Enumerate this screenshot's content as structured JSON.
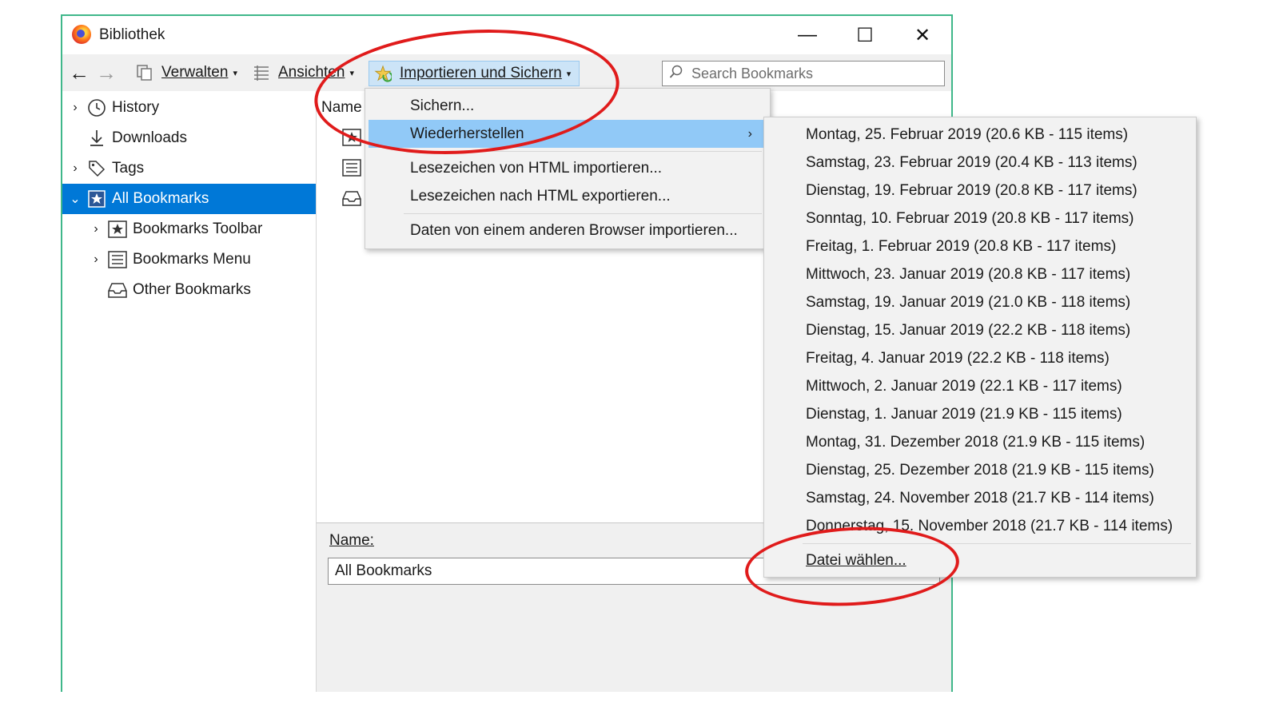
{
  "window": {
    "title": "Bibliothek"
  },
  "toolbar": {
    "verwalten": "Verwalten",
    "ansichten": "Ansichten",
    "import_backup": "Importieren und Sichern",
    "search_placeholder": "Search Bookmarks"
  },
  "sidebar": {
    "items": [
      {
        "label": "History"
      },
      {
        "label": "Downloads"
      },
      {
        "label": "Tags"
      },
      {
        "label": "All Bookmarks"
      },
      {
        "label": "Bookmarks Toolbar"
      },
      {
        "label": "Bookmarks Menu"
      },
      {
        "label": "Other Bookmarks"
      }
    ]
  },
  "list": {
    "column_name": "Name"
  },
  "details": {
    "name_label": "Name:",
    "name_value": "All Bookmarks"
  },
  "import_menu": {
    "items": [
      "Sichern...",
      "Wiederherstellen",
      "Lesezeichen von HTML importieren...",
      "Lesezeichen nach HTML exportieren...",
      "Daten von einem anderen Browser importieren..."
    ]
  },
  "restore_menu": {
    "backups": [
      "Montag, 25. Februar 2019 (20.6 KB - 115 items)",
      "Samstag, 23. Februar 2019 (20.4 KB - 113 items)",
      "Dienstag, 19. Februar 2019 (20.8 KB - 117 items)",
      "Sonntag, 10. Februar 2019 (20.8 KB - 117 items)",
      "Freitag, 1. Februar 2019 (20.8 KB - 117 items)",
      "Mittwoch, 23. Januar 2019 (20.8 KB - 117 items)",
      "Samstag, 19. Januar 2019 (21.0 KB - 118 items)",
      "Dienstag, 15. Januar 2019 (22.2 KB - 118 items)",
      "Freitag, 4. Januar 2019 (22.2 KB - 118 items)",
      "Mittwoch, 2. Januar 2019 (22.1 KB - 117 items)",
      "Dienstag, 1. Januar 2019 (21.9 KB - 115 items)",
      "Montag, 31. Dezember 2018 (21.9 KB - 115 items)",
      "Dienstag, 25. Dezember 2018 (21.9 KB - 115 items)",
      "Samstag, 24. November 2018 (21.7 KB - 114 items)",
      "Donnerstag, 15. November 2018 (21.7 KB - 114 items)"
    ],
    "choose_file": "Datei wählen..."
  },
  "colors": {
    "selection": "#0078d7",
    "menu_highlight": "#91c9f7",
    "annotation": "#e01b1b",
    "window_border": "#3fb78a"
  }
}
